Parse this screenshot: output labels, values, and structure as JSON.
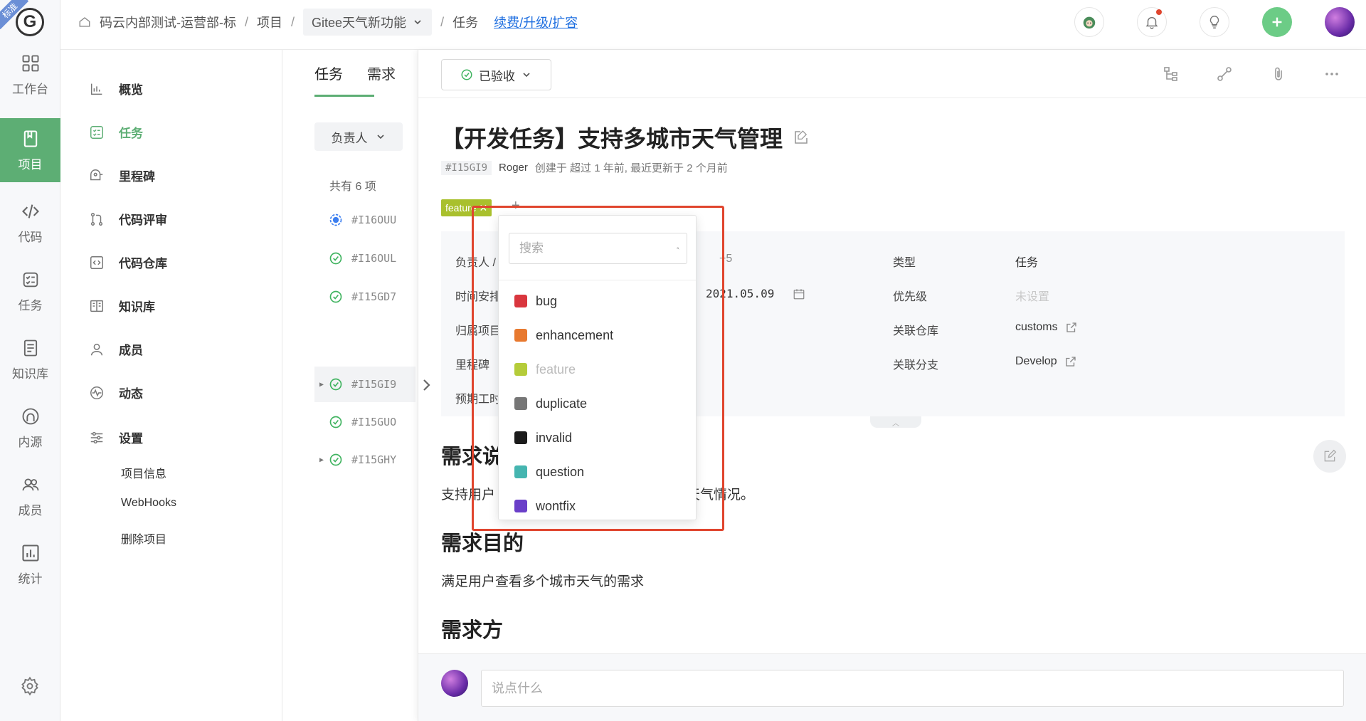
{
  "edition_ribbon": "标准",
  "logo_letter": "G",
  "rail": {
    "items": [
      {
        "label": "工作台",
        "icon": "grid-icon"
      },
      {
        "label": "项目",
        "icon": "book-icon"
      },
      {
        "label": "代码",
        "icon": "code-icon"
      },
      {
        "label": "任务",
        "icon": "checklist-icon"
      },
      {
        "label": "知识库",
        "icon": "document-icon"
      },
      {
        "label": "内源",
        "icon": "inner-source-icon"
      },
      {
        "label": "成员",
        "icon": "members-icon"
      },
      {
        "label": "统计",
        "icon": "bar-chart-icon"
      }
    ],
    "active_index": 1
  },
  "header": {
    "breadcrumb": {
      "org": "码云内部测试-运营部-标",
      "section": "项目",
      "project": "Gitee天气新功能",
      "page": "任务",
      "upgrade_link": "续费/升级/扩容"
    }
  },
  "project_nav": {
    "items": [
      {
        "label": "概览",
        "icon": "bar-chart-icon"
      },
      {
        "label": "任务",
        "icon": "task-list-icon"
      },
      {
        "label": "里程碑",
        "icon": "milestone-icon"
      },
      {
        "label": "代码评审",
        "icon": "pull-request-icon"
      },
      {
        "label": "代码仓库",
        "icon": "repo-icon"
      },
      {
        "label": "知识库",
        "icon": "wiki-icon"
      },
      {
        "label": "成员",
        "icon": "member-icon"
      },
      {
        "label": "动态",
        "icon": "activity-icon"
      },
      {
        "label": "设置",
        "icon": "settings-sliders-icon"
      }
    ],
    "active_index": 1,
    "settings_sub": [
      "项目信息",
      "WebHooks",
      "删除项目"
    ]
  },
  "task_list": {
    "tabs": [
      "任务",
      "需求"
    ],
    "filter_label": "负责人",
    "count_text": "共有 6 项",
    "rows": [
      {
        "id": "#I16OUU",
        "status": "in-progress",
        "has_children": false
      },
      {
        "id": "#I16OUL",
        "status": "accepted",
        "has_children": false
      },
      {
        "id": "#I15GD7",
        "status": "accepted",
        "has_children": false
      },
      {
        "id": "#I15GI9",
        "status": "accepted",
        "has_children": true,
        "selected": true
      },
      {
        "id": "#I15GUO",
        "status": "accepted",
        "has_children": false
      },
      {
        "id": "#I15GHY",
        "status": "accepted",
        "has_children": true
      }
    ]
  },
  "detail": {
    "status_label": "已验收",
    "title": "【开发任务】支持多城市天气管理",
    "id": "#I15GI9",
    "author": "Roger",
    "meta": "创建于 超过 1 年前, 最近更新于 2 个月前",
    "tag": "feature",
    "add_tag": "+",
    "attrs_left": [
      {
        "label": "负责人 / ",
        "value": "+5"
      },
      {
        "label": "时间安排",
        "value": "2021.05.09"
      },
      {
        "label": "归属项目",
        "value": ""
      },
      {
        "label": "里程碑",
        "value": ""
      },
      {
        "label": "预期工时",
        "value": ""
      }
    ],
    "attrs_right": [
      {
        "label": "类型",
        "value": "任务"
      },
      {
        "label": "优先级",
        "value": "未设置"
      },
      {
        "label": "关联仓库",
        "value": "customs"
      },
      {
        "label": "关联分支",
        "value": "Develop"
      }
    ],
    "section1_heading": "需求说",
    "section1_text_a": "支持用户",
    "section1_text_b": "的天气情况。",
    "section2_heading": "需求目的",
    "section2_text": "满足用户查看多个城市天气的需求",
    "section3_heading": "需求方",
    "comment_placeholder": "说点什么"
  },
  "label_dropdown": {
    "search_placeholder": "搜索",
    "options": [
      {
        "name": "bug",
        "color": "#d9363e",
        "disabled": false
      },
      {
        "name": "enhancement",
        "color": "#e8792f",
        "disabled": false
      },
      {
        "name": "feature",
        "color": "#b5cc3a",
        "disabled": true
      },
      {
        "name": "duplicate",
        "color": "#767676",
        "disabled": false
      },
      {
        "name": "invalid",
        "color": "#1b1b1b",
        "disabled": false
      },
      {
        "name": "question",
        "color": "#45b5b0",
        "disabled": false
      },
      {
        "name": "wontfix",
        "color": "#6a3fc9",
        "disabled": false
      }
    ]
  },
  "colors": {
    "brand_green": "#5dae74",
    "highlight_red": "#e0452e",
    "link_blue": "#1f6fe0"
  }
}
